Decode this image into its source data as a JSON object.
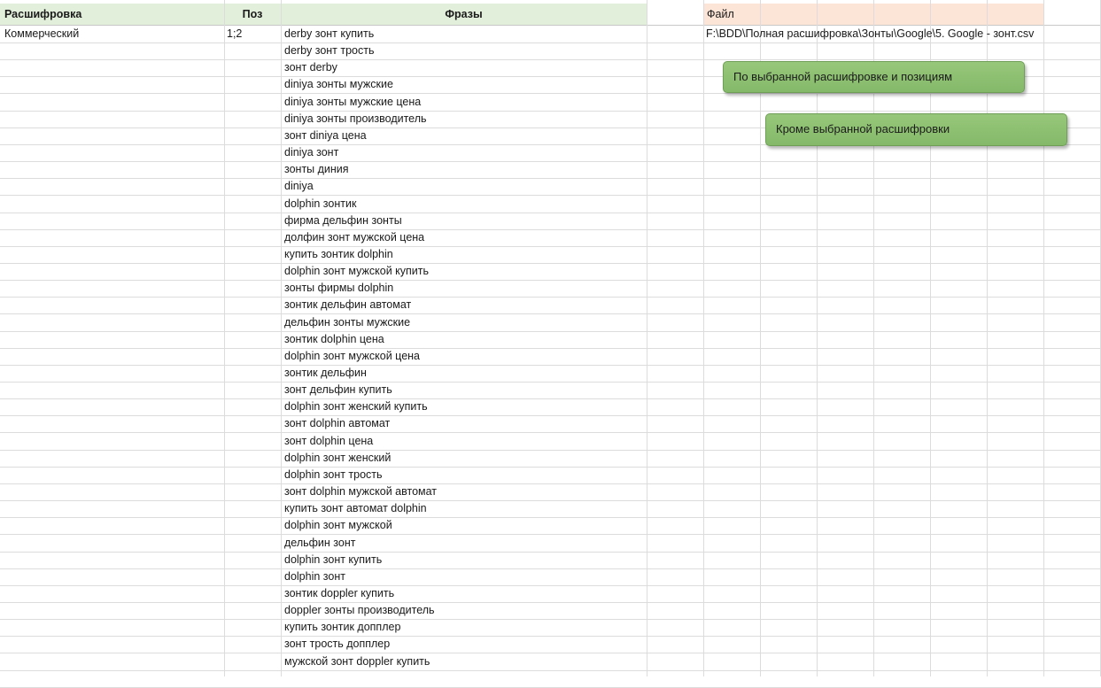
{
  "headers": {
    "rasshifrovka": "Расшифровка",
    "poz": "Поз",
    "frazy": "Фразы",
    "fail": "Файл"
  },
  "first_row": {
    "rasshifrovka": "Коммерческий",
    "poz": "1;2",
    "file_path": "F:\\BDD\\Полная расшифровка\\Зонты\\Google\\5. Google - зонт.csv"
  },
  "phrases": [
    "derby зонт купить",
    "derby зонт трость",
    "зонт derby",
    "diniya зонты мужские",
    "diniya зонты мужские цена",
    "diniya зонты производитель",
    "зонт diniya цена",
    "diniya зонт",
    "зонты диния",
    "diniya",
    "dolphin зонтик",
    "фирма дельфин зонты",
    "долфин зонт мужской цена",
    "купить зонтик dolphin",
    "dolphin зонт мужской купить",
    "зонты фирмы dolphin",
    "зонтик дельфин автомат",
    "дельфин зонты мужские",
    "зонтик dolphin цена",
    "dolphin зонт мужской цена",
    "зонтик дельфин",
    "зонт дельфин купить",
    "dolphin зонт женский купить",
    "зонт dolphin автомат",
    "зонт dolphin цена",
    "dolphin зонт женский",
    "dolphin зонт трость",
    "зонт dolphin мужской автомат",
    "купить зонт автомат dolphin",
    "dolphin зонт мужской",
    "дельфин зонт",
    "dolphin зонт купить",
    "dolphin зонт",
    "зонтик doppler купить",
    "doppler зонты производитель",
    "купить зонтик допплер",
    "зонт трость допплер",
    "мужской зонт doppler купить"
  ],
  "buttons": {
    "by_selected": "По выбранной расшифровке и позициям",
    "except_selected": "Кроме выбранной расшифровки"
  },
  "colors": {
    "header_green": "#e2efda",
    "header_peach": "#fce4d6",
    "button_green": "#8fc275"
  }
}
